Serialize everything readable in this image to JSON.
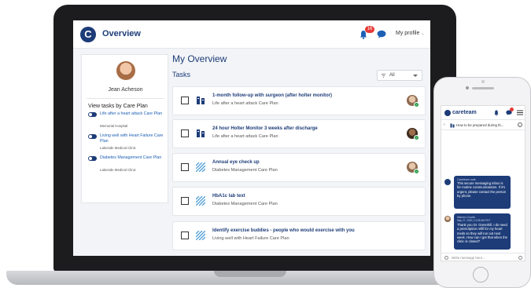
{
  "app": {
    "title": "Overview",
    "notification_count": "16",
    "profile_label": "My profile"
  },
  "user": {
    "name": "Jean Acheson"
  },
  "care_plans": {
    "heading": "View tasks by Care Plan",
    "items": [
      {
        "name": "Life after a heart attack Care Plan",
        "location": "Memorial Hospital"
      },
      {
        "name": "Living well with Heart Failure Care Plan",
        "location": "Lakeside Medical Clinic"
      },
      {
        "name": "Diabetes Management Care Plan",
        "location": "Lakeside Medical Clinic"
      }
    ]
  },
  "main": {
    "title": "My Overview",
    "tasks_label": "Tasks",
    "filter": {
      "selected": "All"
    },
    "tasks": [
      {
        "title": "1-month follow-up with surgeon (after holter monitor)",
        "plan": "Life after a heart attack Care Plan",
        "icon": "building-icon",
        "assignee": "avatar-light",
        "done_badge": true
      },
      {
        "title": "24 hour Holter Monitor 3 weeks after discharge",
        "plan": "Life after a heart attack Care Plan",
        "icon": "building-icon",
        "assignee": "avatar-dark",
        "done_badge": true
      },
      {
        "title": "Annual eye check up",
        "plan": "Diabetes Management Care Plan",
        "icon": "stripes-icon",
        "assignee": "avatar-light",
        "done_badge": true
      },
      {
        "title": "HbA1c lab text",
        "plan": "Diabetes Management Care Plan",
        "icon": "stripes-icon",
        "assignee": null,
        "done_badge": false
      },
      {
        "title": "Identify exercise buddies - people who would exercise with you",
        "plan": "Living well with Heart Failure Care Plan",
        "icon": "stripes-icon",
        "assignee": null,
        "done_badge": false
      }
    ]
  },
  "mobile": {
    "brand": "careteam",
    "subtitle": "How to be prepared during th...",
    "messages": [
      {
        "sender": "Careteam note",
        "time": "",
        "text": "This secure messaging inbox is for routine communications. If it's urgent, please contact the person by phone."
      },
      {
        "sender": "Warren Coutts",
        "time": "May 27, 2020 | 11:55 AM PDT",
        "text": "Thank you Dr. Greenhill. I do need a prescription refill for my heart meds so they will run out next week. How can I get that when the clinic is closed?"
      }
    ],
    "input_placeholder": "Write message here..."
  },
  "colors": {
    "brand": "#1d3c78",
    "link": "#1d5fb5",
    "badge": "#e53935",
    "done": "#2e9e4b",
    "laptop_frame": "#1c1c1e"
  }
}
